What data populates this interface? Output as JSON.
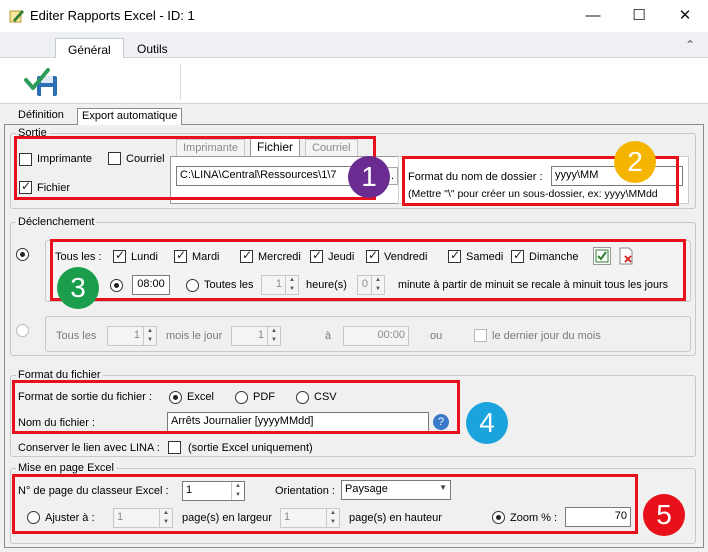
{
  "window": {
    "title": "Editer Rapports Excel - ID: 1",
    "controls": {
      "minimize": "—",
      "maximize": "☐",
      "close": "✕"
    }
  },
  "ribbon": {
    "tabs": [
      "Général",
      "Outils"
    ],
    "collapse_glyph": "⌃",
    "save_icon": "save-check-icon"
  },
  "page_tabs": [
    "Définition",
    "Export automatique"
  ],
  "sortie": {
    "legend": "Sortie",
    "imprimante_label": "Imprimante",
    "courriel_label": "Courriel",
    "fichier_label": "Fichier",
    "fichier_checked": true,
    "imprimante_checked": false,
    "courriel_checked": false,
    "output_tabs": [
      "Imprimante",
      "Fichier",
      "Courriel"
    ],
    "path_value": "C:\\LINA\\Central\\Ressources\\1\\7",
    "folder_format_label": "Format du nom de dossier :",
    "folder_format_value": "yyyy\\MM",
    "folder_hint": "(Mettre \"\\\" pour créer un sous-dossier, ex: yyyy\\MMdd"
  },
  "declenchement": {
    "legend": "Déclenchement",
    "tous_les_label": "Tous les :",
    "days": [
      {
        "label": "Lundi",
        "checked": true
      },
      {
        "label": "Mardi",
        "checked": true
      },
      {
        "label": "Mercredi",
        "checked": true
      },
      {
        "label": "Jeudi",
        "checked": true
      },
      {
        "label": "Vendredi",
        "checked": true
      },
      {
        "label": "Samedi",
        "checked": true
      },
      {
        "label": "Dimanche",
        "checked": true
      }
    ],
    "time_value": "08:00",
    "toutes_les_label": "Toutes les",
    "hours_value": "1",
    "heures_label": "heure(s)",
    "minutes_value": "0",
    "minute_text": "minute à partir de minuit se recale à minuit tous les jours",
    "monthly": {
      "tous_les": "Tous les",
      "months_value": "1",
      "mois_le_jour": "mois le jour",
      "day_value": "1",
      "a_label": "à",
      "time_value": "00:00",
      "ou_label": "ou",
      "last_day_label": "le dernier jour du mois"
    }
  },
  "format_fichier": {
    "legend": "Format du fichier",
    "sortie_label": "Format de sortie du fichier :",
    "options": [
      {
        "label": "Excel",
        "selected": true
      },
      {
        "label": "PDF",
        "selected": false
      },
      {
        "label": "CSV",
        "selected": false
      }
    ],
    "nom_label": "Nom du fichier :",
    "nom_value": "Arrêts Journalier [yyyyMMdd]",
    "conserver_label": "Conserver le lien avec LINA :",
    "conserver_hint": "(sortie Excel uniquement)"
  },
  "mise_en_page": {
    "legend": "Mise en page Excel",
    "page_label": "N° de page du classeur Excel :",
    "page_value": "1",
    "orientation_label": "Orientation :",
    "orientation_value": "Paysage",
    "ajuster_label": "Ajuster à :",
    "largeur_value": "1",
    "largeur_label": "page(s) en largeur",
    "hauteur_value": "1",
    "hauteur_label": "page(s) en hauteur",
    "zoom_label": "Zoom % :",
    "zoom_value": "70"
  },
  "badges": [
    {
      "number": "1",
      "color": "#6a2c91"
    },
    {
      "number": "2",
      "color": "#f5b400"
    },
    {
      "number": "3",
      "color": "#1a9e4b"
    },
    {
      "number": "4",
      "color": "#1aa3dc"
    },
    {
      "number": "5",
      "color": "#e8101a"
    }
  ]
}
